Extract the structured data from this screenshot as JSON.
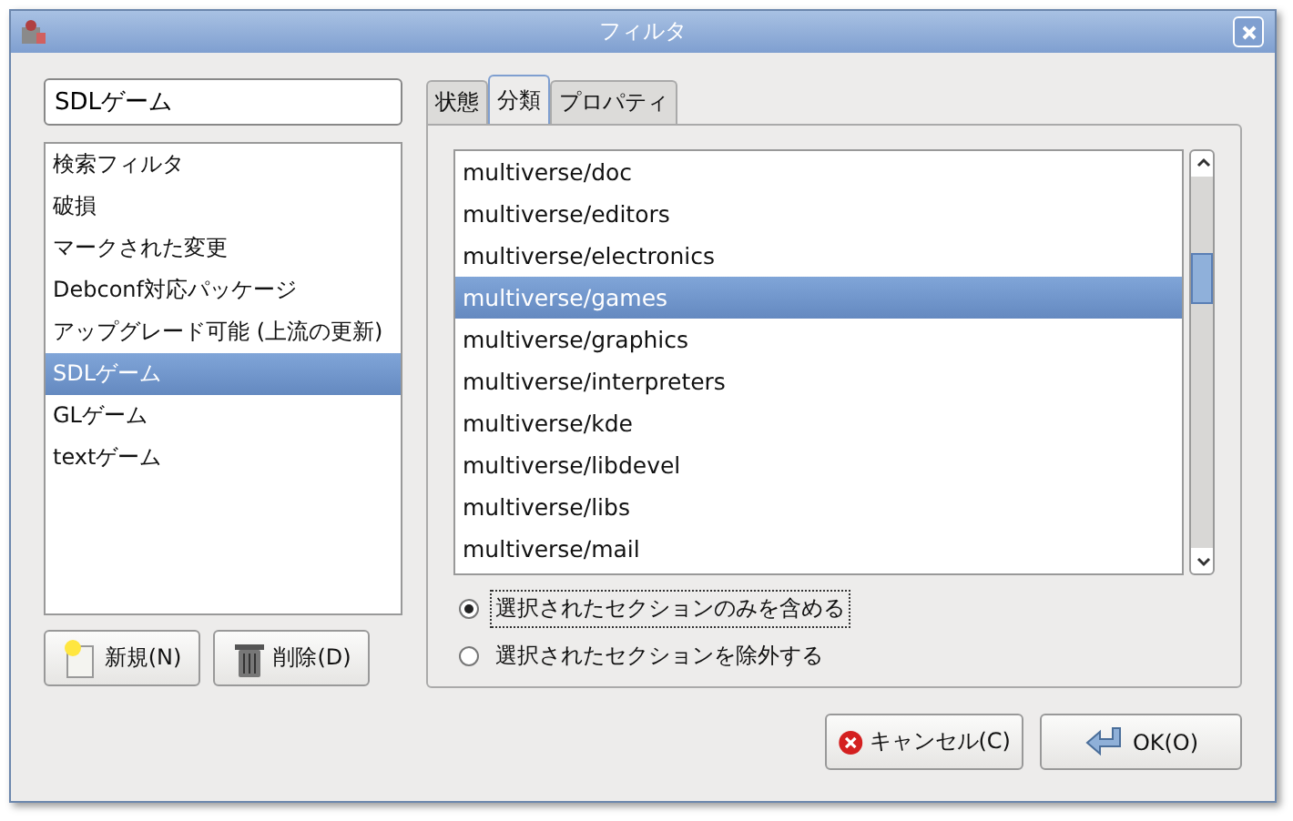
{
  "window": {
    "title": "フィルタ"
  },
  "name_field": {
    "value": "SDLゲーム"
  },
  "filters": [
    {
      "label": "検索フィルタ",
      "selected": false
    },
    {
      "label": "破損",
      "selected": false
    },
    {
      "label": "マークされた変更",
      "selected": false
    },
    {
      "label": "Debconf対応パッケージ",
      "selected": false
    },
    {
      "label": "アップグレード可能 (上流の更新)",
      "selected": false
    },
    {
      "label": "SDLゲーム",
      "selected": true
    },
    {
      "label": "GLゲーム",
      "selected": false
    },
    {
      "label": "textゲーム",
      "selected": false
    }
  ],
  "filter_buttons": [
    {
      "kind": "new",
      "label": "新規(N)"
    },
    {
      "kind": "delete",
      "label": "削除(D)"
    }
  ],
  "tabs": [
    {
      "label": "状態",
      "selected": false
    },
    {
      "label": "分類",
      "selected": true
    },
    {
      "label": "プロパティ",
      "selected": false
    }
  ],
  "sections": [
    {
      "label": "multiverse/doc",
      "selected": false
    },
    {
      "label": "multiverse/editors",
      "selected": false
    },
    {
      "label": "multiverse/electronics",
      "selected": false
    },
    {
      "label": "multiverse/games",
      "selected": true
    },
    {
      "label": "multiverse/graphics",
      "selected": false
    },
    {
      "label": "multiverse/interpreters",
      "selected": false
    },
    {
      "label": "multiverse/kde",
      "selected": false
    },
    {
      "label": "multiverse/libdevel",
      "selected": false
    },
    {
      "label": "multiverse/libs",
      "selected": false
    },
    {
      "label": "multiverse/mail",
      "selected": false
    }
  ],
  "mode_options": [
    {
      "label": "選択されたセクションのみを含める",
      "selected": true
    },
    {
      "label": "選択されたセクションを除外する",
      "selected": false
    }
  ],
  "dialog_buttons": [
    {
      "kind": "cancel",
      "label": "キャンセル(C)"
    },
    {
      "kind": "ok",
      "label": "OK(O)"
    }
  ]
}
